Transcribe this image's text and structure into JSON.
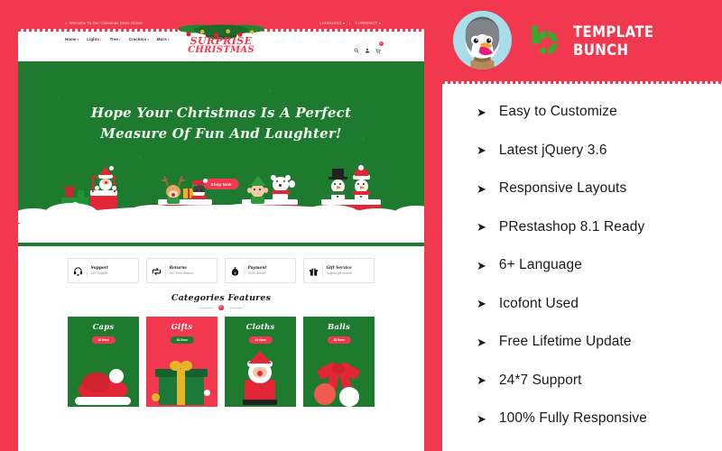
{
  "site": {
    "topbar": {
      "welcome": "Welcome To Our Christmas Store Online",
      "home_icon": "home-icon",
      "language": "LANGUAGE",
      "currency": "CURRENCY",
      "sep": "|",
      "caret": "▾"
    },
    "nav": {
      "items": [
        {
          "label": "Home"
        },
        {
          "label": "Lights"
        },
        {
          "label": "Tree"
        },
        {
          "label": "Crackers"
        },
        {
          "label": "More"
        }
      ],
      "caret": "▾",
      "cart_count": "0"
    },
    "logo": {
      "line1": "SURPRISE",
      "line2": "CHRISTMAS"
    },
    "hero": {
      "line1": "Hope Your Christmas Is A Perfect",
      "line2": "Measure Of Fun And Laughter!",
      "button": "Shop Now"
    },
    "services": [
      {
        "title": "Support",
        "sub": "24/7 Support",
        "icon": "headset-icon"
      },
      {
        "title": "Returns",
        "sub": "24/7 Free Returns",
        "icon": "exchange-icon"
      },
      {
        "title": "Payment",
        "sub": "100% Secure",
        "icon": "money-bag-icon"
      },
      {
        "title": "Gift Service",
        "sub": "Support gift service",
        "icon": "gift-icon"
      }
    ],
    "categories": {
      "title": "Categories Features",
      "items": [
        {
          "name": "Caps",
          "count": "18 Item",
          "theme": "green"
        },
        {
          "name": "Gifts",
          "count": "18 Item",
          "theme": "red"
        },
        {
          "name": "Cloths",
          "count": "18 Item",
          "theme": "green"
        },
        {
          "name": "Balls",
          "count": "18 Item",
          "theme": "green"
        }
      ]
    }
  },
  "promo": {
    "brand_name": "TEMPLATE BUNCH",
    "prestashop_logo": "prestashop-mascot-icon",
    "bunch_mark": "template-bunch-mark-icon",
    "arrow": "➤",
    "features": [
      "Easy to Customize",
      "Latest jQuery 3.6",
      "Responsive Layouts",
      "PRestashop 8.1 Ready",
      "6+ Language",
      "Icofont Used",
      "Free Lifetime Update",
      "24*7 Support",
      "100% Fully Responsive"
    ]
  },
  "colors": {
    "brand_red": "#f2384f",
    "brand_green": "#1e7a2e",
    "accent_green": "#3aa757",
    "white": "#ffffff"
  }
}
